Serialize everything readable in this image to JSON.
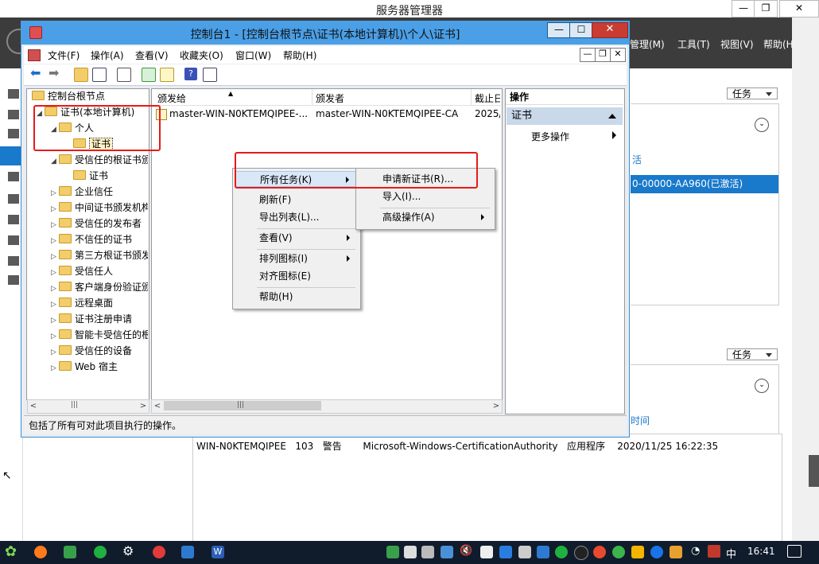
{
  "server_manager": {
    "title": "服务器管理器",
    "window_controls": [
      "—",
      "❐",
      "✕"
    ],
    "menus": [
      "管理(M)",
      "工具(T)",
      "视图(V)",
      "帮助(H)"
    ],
    "tasks_label_1": "任务",
    "tasks_label_2": "任务",
    "link_1": "活",
    "selected_row": "0-00000-AA960(已激活)",
    "link_2": "时间",
    "event_row": "WIN-N0KTEMQIPEE   103   警告       Microsoft-Windows-CertificationAuthority   应用程序    2020/11/25 16:22:35",
    "colors": {
      "header": "#3c3c3c",
      "accent": "#1979ca"
    }
  },
  "console": {
    "title": "控制台1 - [控制台根节点\\证书(本地计算机)\\个人\\证书]",
    "window_controls": [
      "—",
      "☐",
      "✕"
    ],
    "inner_controls": [
      "—",
      "❐",
      "✕"
    ],
    "menus": [
      "文件(F)",
      "操作(A)",
      "查看(V)",
      "收藏夹(O)",
      "窗口(W)",
      "帮助(H)"
    ],
    "toolbar_icons": [
      "back-arrow-icon",
      "forward-arrow-icon",
      "up-folder-icon",
      "show-tree-icon",
      "properties-icon",
      "refresh-icon",
      "export-list-icon",
      "help-icon",
      "show-action-pane-icon"
    ],
    "tree": {
      "root": "控制台根节点",
      "items": [
        {
          "label": "证书(本地计算机)",
          "level": 1,
          "expander": "◢"
        },
        {
          "label": "个人",
          "level": 2,
          "expander": "◢"
        },
        {
          "label": "证书",
          "level": 3,
          "expander": "",
          "selected": true
        },
        {
          "label": "受信任的根证书颁发机构",
          "level": 2,
          "expander": "◢"
        },
        {
          "label": "证书",
          "level": 3,
          "expander": ""
        },
        {
          "label": "企业信任",
          "level": 2,
          "expander": "▷"
        },
        {
          "label": "中间证书颁发机构",
          "level": 2,
          "expander": "▷"
        },
        {
          "label": "受信任的发布者",
          "level": 2,
          "expander": "▷"
        },
        {
          "label": "不信任的证书",
          "level": 2,
          "expander": "▷"
        },
        {
          "label": "第三方根证书颁发机构",
          "level": 2,
          "expander": "▷"
        },
        {
          "label": "受信任人",
          "level": 2,
          "expander": "▷"
        },
        {
          "label": "客户端身份验证颁发者",
          "level": 2,
          "expander": "▷"
        },
        {
          "label": "远程桌面",
          "level": 2,
          "expander": "▷"
        },
        {
          "label": "证书注册申请",
          "level": 2,
          "expander": "▷"
        },
        {
          "label": "智能卡受信任的根",
          "level": 2,
          "expander": "▷"
        },
        {
          "label": "受信任的设备",
          "level": 2,
          "expander": "▷"
        },
        {
          "label": "Web 宿主",
          "level": 2,
          "expander": "▷"
        }
      ]
    },
    "list": {
      "columns": [
        "颁发给",
        "颁发者",
        "截止日"
      ],
      "rows": [
        {
          "issued_to": "master-WIN-N0KTEMQIPEE-...",
          "issued_by": "master-WIN-N0KTEMQIPEE-CA",
          "expires": "2025/"
        }
      ]
    },
    "actions": {
      "header": "操作",
      "section": "证书",
      "more": "更多操作"
    },
    "status": "包括了所有可对此项目执行的操作。",
    "context_menu": {
      "items": [
        {
          "label": "所有任务(K)",
          "submenu": true
        },
        {
          "label": "刷新(F)"
        },
        {
          "label": "导出列表(L)..."
        },
        {
          "label": "查看(V)",
          "submenu": true
        },
        {
          "label": "排列图标(I)",
          "submenu": true
        },
        {
          "label": "对齐图标(E)"
        },
        {
          "label": "帮助(H)"
        }
      ]
    },
    "submenu": {
      "items": [
        {
          "label": "申请新证书(R)..."
        },
        {
          "label": "导入(I)..."
        },
        {
          "label": "高级操作(A)",
          "submenu": true
        }
      ]
    }
  },
  "taskbar": {
    "ime": "中",
    "time": "16:41"
  }
}
